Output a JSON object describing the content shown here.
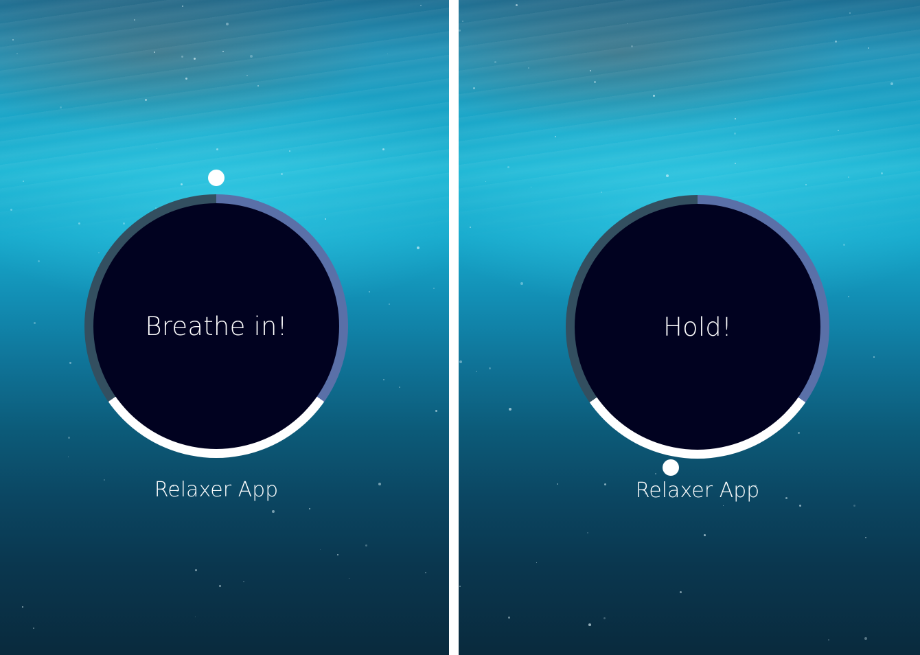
{
  "screens": [
    {
      "instruction": "Breathe in!",
      "app_title": "Relaxer App",
      "phase_progress": 0.0
    },
    {
      "instruction": "Hold!",
      "app_title": "Relaxer App",
      "phase_progress": 0.45
    }
  ],
  "colors": {
    "circle_fill": "#010220",
    "ring_inhale_segment": "#5a70a8",
    "ring_hold_segment": "#ffffff",
    "ring_exhale_segment": "#334f60",
    "pointer": "#ffffff",
    "text": "#ffffff"
  }
}
